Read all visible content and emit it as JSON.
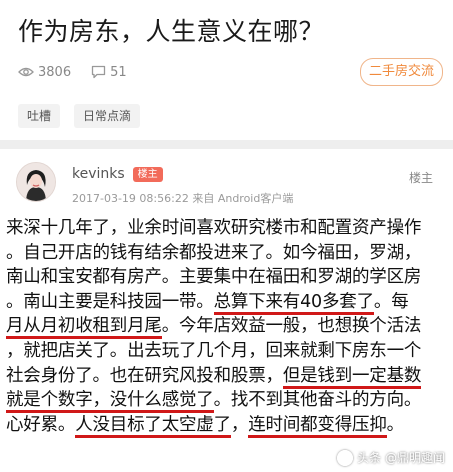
{
  "post": {
    "title": "作为房东，人生意义在哪？",
    "views": "3806",
    "comments": "51",
    "category": "二手房交流",
    "tags": [
      "吐槽",
      "日常点滴"
    ]
  },
  "reply": {
    "username": "kevinks",
    "badge": "楼主",
    "meta": "2017-03-19 08:56:22  来自 Android客户端",
    "floor": "楼主",
    "lines": [
      [
        {
          "t": "来深十几年了，业余时间喜欢研究楼市和配置资产操作"
        }
      ],
      [
        {
          "t": "。自己开店的钱有结余都投进来了。如今福田，罗湖，"
        }
      ],
      [
        {
          "t": "南山和宝安都有房产。主要集中在福田和罗湖的学区房"
        }
      ],
      [
        {
          "t": "。南山主要是科技园一带。"
        },
        {
          "t": "总算下来有40多套了",
          "hl": true
        },
        {
          "t": "。每"
        }
      ],
      [
        {
          "t": "月从月初收租到月尾",
          "hl": true
        },
        {
          "t": "。今年店效益一般，也想换个活法"
        }
      ],
      [
        {
          "t": "，就把店关了。出去玩了几个月，回来就剩下房东一个"
        }
      ],
      [
        {
          "t": "社会身份了。也在研究风投和股票，"
        },
        {
          "t": "但是钱到一定基数",
          "hl": true
        }
      ],
      [
        {
          "t": "就是个数字，没什么感觉了",
          "hl": true
        },
        {
          "t": "。找不到其他奋斗的方向。"
        }
      ],
      [
        {
          "t": "心好累。"
        },
        {
          "t": "人没目标了太空虚了",
          "hl": true
        },
        {
          "t": "，"
        },
        {
          "t": "连时间都变得压抑",
          "hl": true
        },
        {
          "t": "。"
        }
      ]
    ]
  },
  "watermark": "头条 @鼎明趣闻",
  "colors": {
    "accent": "#f08a3c",
    "highlight": "#d01818",
    "badge": "#f26b5a"
  }
}
